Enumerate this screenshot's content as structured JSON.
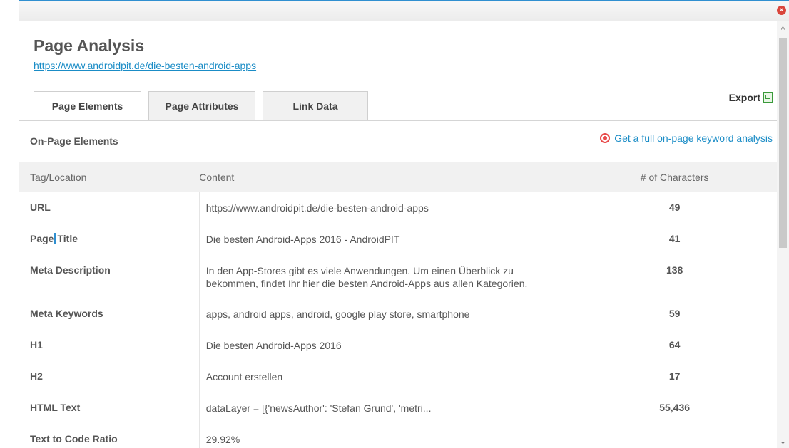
{
  "window": {
    "close_symbol": "×"
  },
  "header": {
    "title": "Page Analysis",
    "url": "https://www.androidpit.de/die-besten-android-apps"
  },
  "tabs": [
    {
      "label": "Page Elements",
      "active": true
    },
    {
      "label": "Page Attributes",
      "active": false
    },
    {
      "label": "Link Data",
      "active": false
    }
  ],
  "export": {
    "label": "Export",
    "icon": "excel-icon"
  },
  "section": {
    "label": "On-Page Elements",
    "keyword_link": "Get a full on-page keyword analysis",
    "keyword_icon": "target-icon"
  },
  "table": {
    "headers": {
      "tag": "Tag/Location",
      "content": "Content",
      "chars": "# of Characters"
    },
    "rows": [
      {
        "tag": "URL",
        "content": "https://www.androidpit.de/die-besten-android-apps",
        "chars": "49"
      },
      {
        "tag_a": "Page",
        "tag_b": "Title",
        "content": "Die besten Android-Apps 2016 - AndroidPIT",
        "chars": "41"
      },
      {
        "tag": "Meta Description",
        "content_line1": "In den App-Stores gibt es viele Anwendungen. Um einen Überblick zu",
        "content_line2": "bekommen, findet Ihr hier die besten Android-Apps aus allen Kategorien.",
        "chars": "138"
      },
      {
        "tag": "Meta Keywords",
        "content": "apps, android apps, android, google play store, smartphone",
        "chars": "59"
      },
      {
        "tag": "H1",
        "content": "Die besten Android-Apps 2016",
        "chars": "64"
      },
      {
        "tag": "H2",
        "content": "Account erstellen",
        "chars": "17"
      },
      {
        "tag": "HTML Text",
        "content": "dataLayer = [{'newsAuthor': 'Stefan Grund', 'metri...",
        "chars": "55,436"
      },
      {
        "tag": "Text to Code Ratio",
        "content": "29.92%",
        "chars": ""
      }
    ]
  },
  "scrollbar": {
    "up": "^",
    "down": "⌄"
  }
}
